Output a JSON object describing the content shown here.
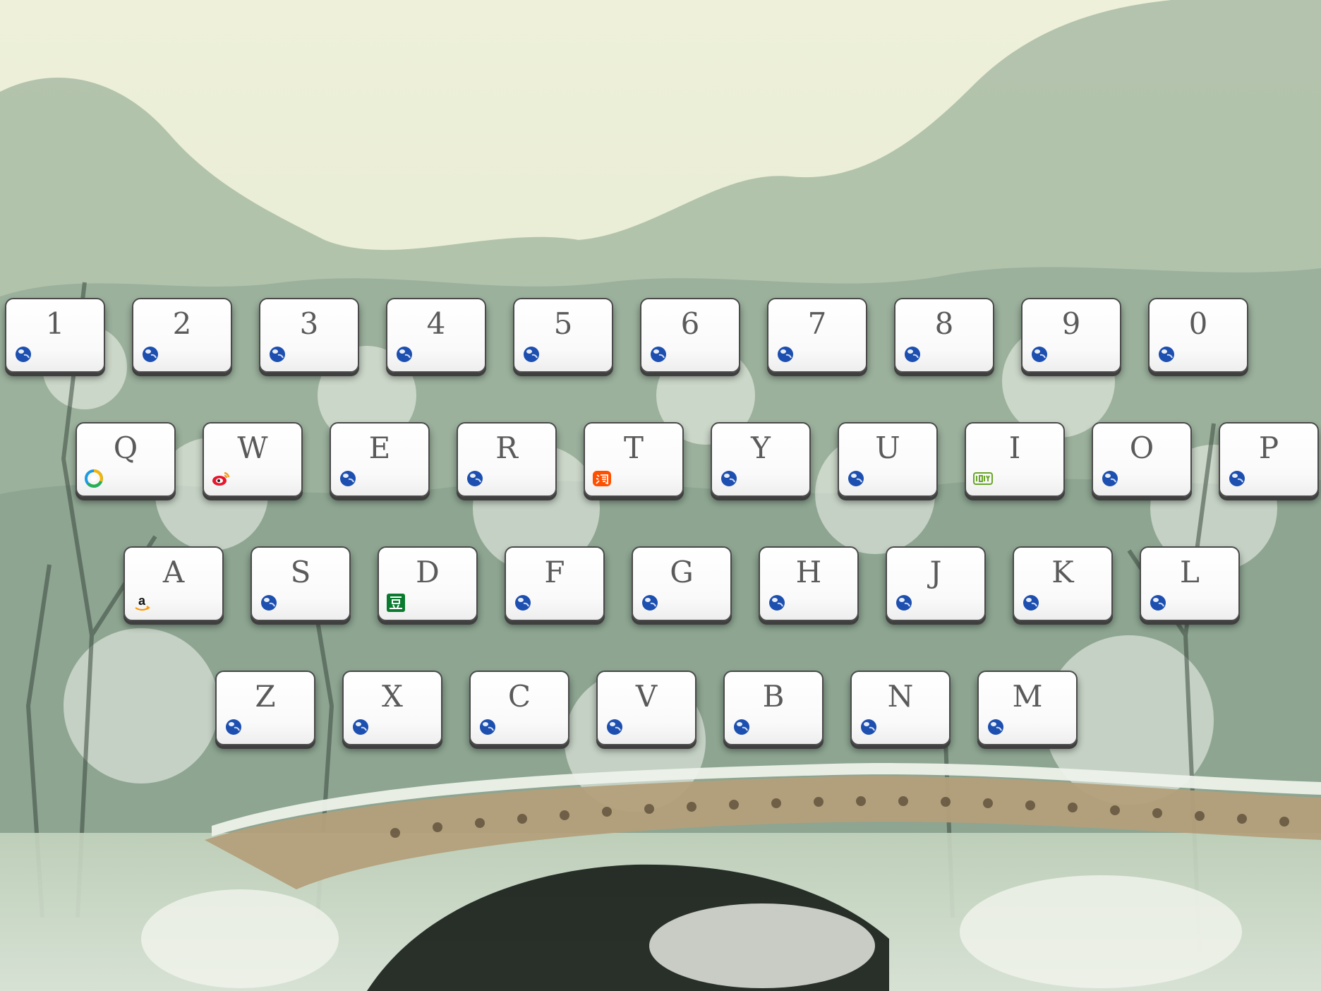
{
  "keyboard": {
    "rows": [
      {
        "keys": [
          {
            "label": "1",
            "icon": "globe-icon"
          },
          {
            "label": "2",
            "icon": "globe-icon"
          },
          {
            "label": "3",
            "icon": "globe-icon"
          },
          {
            "label": "4",
            "icon": "globe-icon"
          },
          {
            "label": "5",
            "icon": "globe-icon"
          },
          {
            "label": "6",
            "icon": "globe-icon"
          },
          {
            "label": "7",
            "icon": "globe-icon"
          },
          {
            "label": "8",
            "icon": "globe-icon"
          },
          {
            "label": "9",
            "icon": "globe-icon"
          },
          {
            "label": "0",
            "icon": "globe-icon"
          }
        ]
      },
      {
        "keys": [
          {
            "label": "Q",
            "icon": "tencent-news-icon"
          },
          {
            "label": "W",
            "icon": "weibo-icon"
          },
          {
            "label": "E",
            "icon": "globe-icon"
          },
          {
            "label": "R",
            "icon": "globe-icon"
          },
          {
            "label": "T",
            "icon": "taobao-icon"
          },
          {
            "label": "Y",
            "icon": "globe-icon"
          },
          {
            "label": "U",
            "icon": "globe-icon"
          },
          {
            "label": "I",
            "icon": "iqiyi-icon"
          },
          {
            "label": "O",
            "icon": "globe-icon"
          },
          {
            "label": "P",
            "icon": "globe-icon"
          }
        ]
      },
      {
        "keys": [
          {
            "label": "A",
            "icon": "amazon-icon"
          },
          {
            "label": "S",
            "icon": "globe-icon"
          },
          {
            "label": "D",
            "icon": "douban-icon"
          },
          {
            "label": "F",
            "icon": "globe-icon"
          },
          {
            "label": "G",
            "icon": "globe-icon"
          },
          {
            "label": "H",
            "icon": "globe-icon"
          },
          {
            "label": "J",
            "icon": "globe-icon"
          },
          {
            "label": "K",
            "icon": "globe-icon"
          },
          {
            "label": "L",
            "icon": "globe-icon"
          }
        ]
      },
      {
        "keys": [
          {
            "label": "Z",
            "icon": "globe-icon"
          },
          {
            "label": "X",
            "icon": "globe-icon"
          },
          {
            "label": "C",
            "icon": "globe-icon"
          },
          {
            "label": "V",
            "icon": "globe-icon"
          },
          {
            "label": "B",
            "icon": "globe-icon"
          },
          {
            "label": "N",
            "icon": "globe-icon"
          },
          {
            "label": "M",
            "icon": "globe-icon"
          }
        ]
      }
    ]
  },
  "colors": {
    "key_face": "#ffffff",
    "key_border": "#4a4a4a",
    "key_text": "#5a5a5a",
    "globe_icon": "#1c4fb0",
    "weibo_icon": "#e6162d",
    "taobao_icon": "#ff5000",
    "iqiyi_icon": "#6aa52a",
    "douban_icon": "#0a7a2f",
    "amazon_smile": "#ff9900"
  }
}
